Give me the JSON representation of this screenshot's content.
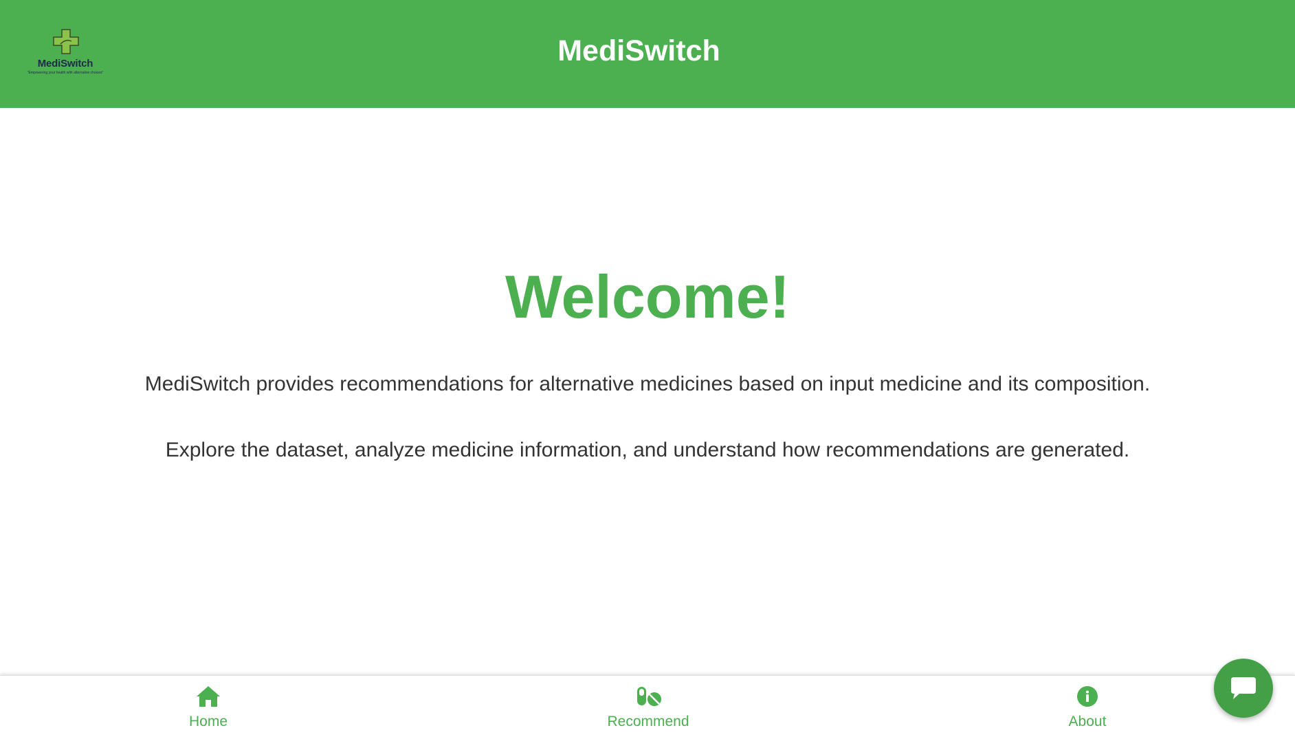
{
  "header": {
    "title": "MediSwitch",
    "logo": {
      "name": "MediSwitch",
      "tagline": "\"Empowering your health with alternative choices\""
    }
  },
  "main": {
    "heading": "Welcome!",
    "paragraphs": [
      "MediSwitch provides recommendations for alternative medicines based on input medicine and its composition.",
      "Explore the dataset, analyze medicine information, and understand how recommendations are generated."
    ]
  },
  "bottom_nav": {
    "items": [
      {
        "label": "Home",
        "icon": "home-icon"
      },
      {
        "label": "Recommend",
        "icon": "pills-icon"
      },
      {
        "label": "About",
        "icon": "info-icon"
      }
    ]
  },
  "chat": {
    "icon": "chat-bubble-icon"
  },
  "colors": {
    "brand": "#4caf50",
    "text": "#333333",
    "background": "#ffffff"
  }
}
